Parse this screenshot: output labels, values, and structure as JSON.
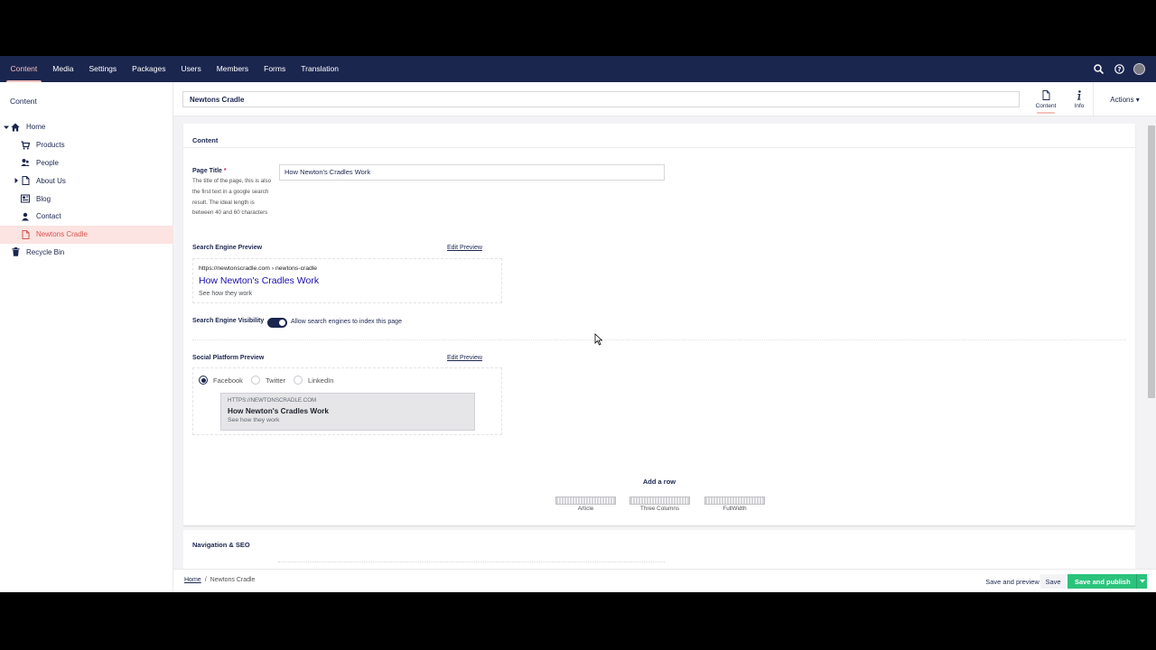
{
  "topnav": {
    "items": [
      "Content",
      "Media",
      "Settings",
      "Packages",
      "Users",
      "Members",
      "Forms",
      "Translation"
    ],
    "active_index": 0,
    "icons": [
      "search-icon",
      "help-icon",
      "user-avatar"
    ]
  },
  "sidebar": {
    "title": "Content",
    "tree": [
      {
        "label": "Home",
        "icon": "home-icon",
        "expanded": true
      },
      {
        "label": "Products",
        "icon": "cart-icon"
      },
      {
        "label": "People",
        "icon": "people-icon"
      },
      {
        "label": "About Us",
        "icon": "document-icon",
        "has_children": true
      },
      {
        "label": "Blog",
        "icon": "newspaper-icon"
      },
      {
        "label": "Contact",
        "icon": "contact-icon"
      },
      {
        "label": "Newtons Cradle",
        "icon": "document-icon",
        "selected": true
      },
      {
        "label": "Recycle Bin",
        "icon": "trash-icon"
      }
    ]
  },
  "editor": {
    "node_name": "Newtons Cradle",
    "tabs": [
      {
        "label": "Content",
        "icon": "document-icon",
        "active": true
      },
      {
        "label": "Info",
        "icon": "info-icon"
      }
    ],
    "actions_label": "Actions ▾"
  },
  "content_group": {
    "title": "Content",
    "page_title": {
      "label": "Page Title",
      "required_mark": "*",
      "description": "The title of the page, this is also the first text in a google search result. The ideal length is between 40 and 60 characters",
      "value": "How Newton's Cradles Work"
    },
    "search_preview": {
      "label": "Search Engine Preview",
      "edit_link": "Edit Preview",
      "url": "https://newtonscradle.com › newtons-cradle",
      "title": "How Newton's Cradles Work",
      "description": "See how they work"
    },
    "visibility": {
      "label": "Search Engine Visibility",
      "toggle_on": true,
      "toggle_label": "Allow search engines to index this page"
    },
    "social_preview": {
      "label": "Social Platform Preview",
      "edit_link": "Edit Preview",
      "platforms": [
        "Facebook",
        "Twitter",
        "LinkedIn"
      ],
      "selected": "Facebook",
      "card_url": "HTTPS://NEWTONSCRADLE.COM",
      "card_title": "How Newton's Cradles Work",
      "card_description": "See how they work"
    },
    "add_row": {
      "title": "Add a row",
      "layouts": [
        "Article",
        "Three Columns",
        "FullWidth"
      ]
    }
  },
  "nav_group": {
    "title": "Navigation & SEO"
  },
  "footer": {
    "breadcrumb_home": "Home",
    "breadcrumb_sep": "/",
    "breadcrumb_current": "Newtons Cradle",
    "save_preview": "Save and preview",
    "save": "Save",
    "publish": "Save and publish"
  },
  "colors": {
    "nav_bg": "#1b264f",
    "accent": "#f5c1bc",
    "publish": "#2bc37c",
    "seo_link": "#1a0dab"
  }
}
